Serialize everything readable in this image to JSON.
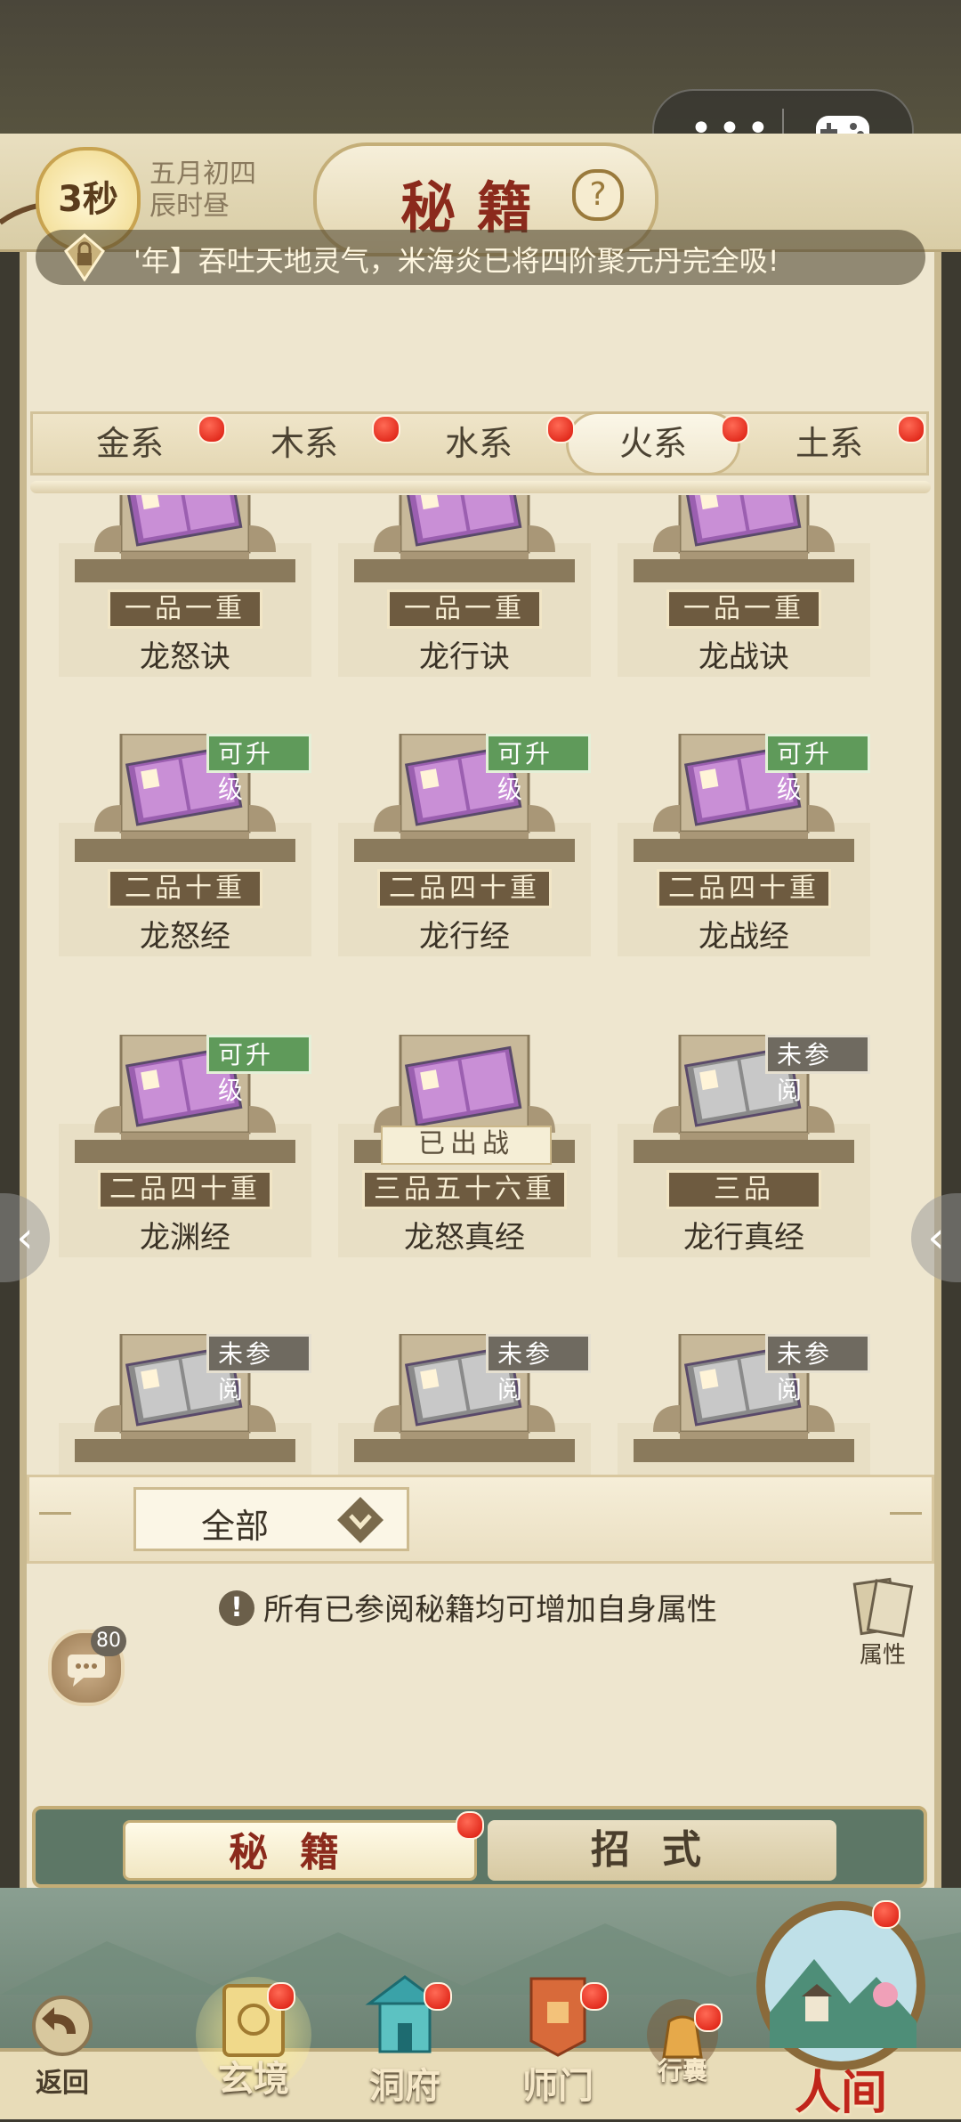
{
  "capsule": {
    "more_glyph": "•••",
    "game_icon": "gamepad-icon"
  },
  "header": {
    "timer": "3秒",
    "date_line1": "五月初四",
    "date_line2": "辰时昼",
    "title": "秘籍",
    "help": "?"
  },
  "marquee": {
    "text": "'年】吞吐天地灵气，米海炎已将四阶聚元丹完全吸!"
  },
  "tabs": [
    {
      "label": "金系",
      "dot": true
    },
    {
      "label": "木系",
      "dot": true
    },
    {
      "label": "水系",
      "dot": true
    },
    {
      "label": "火系",
      "dot": true,
      "active": true
    },
    {
      "label": "土系",
      "dot": true
    }
  ],
  "books": [
    {
      "level": "一品一重",
      "name": "龙怒诀",
      "badge": "",
      "status": "",
      "color": "purple"
    },
    {
      "level": "一品一重",
      "name": "龙行诀",
      "badge": "",
      "status": "",
      "color": "purple"
    },
    {
      "level": "一品一重",
      "name": "龙战诀",
      "badge": "",
      "status": "",
      "color": "purple"
    },
    {
      "level": "二品十重",
      "name": "龙怒经",
      "badge": "可升级",
      "status": "",
      "color": "purple"
    },
    {
      "level": "二品四十重",
      "name": "龙行经",
      "badge": "可升级",
      "status": "",
      "color": "purple"
    },
    {
      "level": "二品四十重",
      "name": "龙战经",
      "badge": "可升级",
      "status": "",
      "color": "purple"
    },
    {
      "level": "二品四十重",
      "name": "龙渊经",
      "badge": "可升级",
      "status": "",
      "color": "purple"
    },
    {
      "level": "三品五十六重",
      "name": "龙怒真经",
      "badge": "",
      "status": "已出战",
      "color": "purple"
    },
    {
      "level": "三品",
      "name": "龙行真经",
      "badge": "未参阅",
      "status": "",
      "color": "gray"
    },
    {
      "level": "",
      "name": "",
      "badge": "未参阅",
      "status": "",
      "color": "gray"
    },
    {
      "level": "",
      "name": "",
      "badge": "未参阅",
      "status": "",
      "color": "gray"
    },
    {
      "level": "",
      "name": "",
      "badge": "未参阅",
      "status": "",
      "color": "gray"
    }
  ],
  "filter": {
    "label": "全部"
  },
  "info": {
    "text": "所有已参阅秘籍均可增加自身属性"
  },
  "attr_button": {
    "label": "属性"
  },
  "chat": {
    "count": "80"
  },
  "switch": {
    "active": "秘籍",
    "inactive": "招式"
  },
  "nav": {
    "back": "返回",
    "items": [
      "玄境",
      "洞府",
      "师门",
      "行囊"
    ],
    "world": "人间"
  },
  "colors": {
    "accent_red": "#d8160a",
    "upgrade_green": "#5f9a5a",
    "panel_bg": "#eee6cf"
  }
}
